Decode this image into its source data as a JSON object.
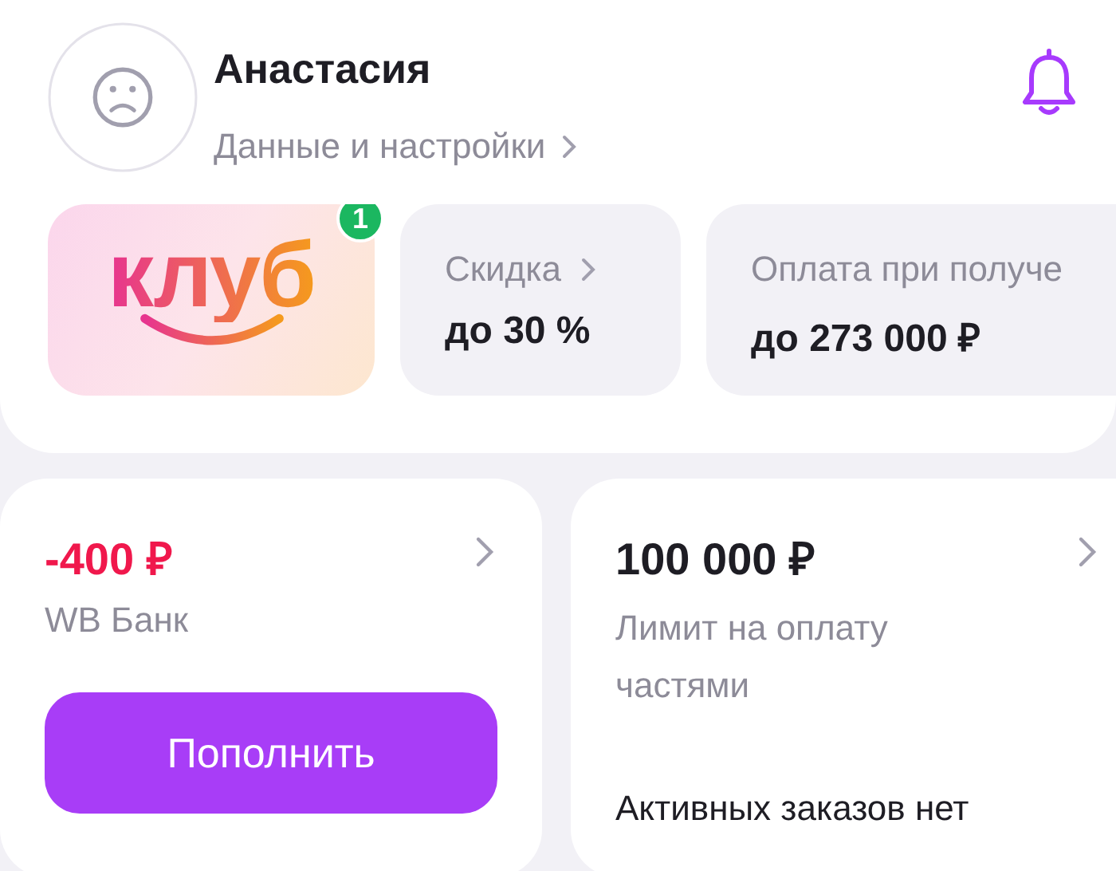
{
  "profile": {
    "name": "Анастасия",
    "link": "Данные и настройки"
  },
  "tiles": [
    {
      "kind": "club",
      "logo": "клуб",
      "badge": "1"
    },
    {
      "kind": "info",
      "title": "Скидка",
      "value": "до 30 %",
      "chevron": true
    },
    {
      "kind": "info",
      "title": "Оплата при получе",
      "value": "до 273 000 ₽",
      "chevron": false
    }
  ],
  "cards": [
    {
      "kind": "balance",
      "amount": "-400 ₽",
      "negative": true,
      "label": "WB Банк",
      "button": "Пополнить"
    },
    {
      "kind": "installments",
      "amount": "100 000 ₽",
      "negative": false,
      "label": "Лимит на оплату частями",
      "note": "Активных заказов нет"
    }
  ]
}
